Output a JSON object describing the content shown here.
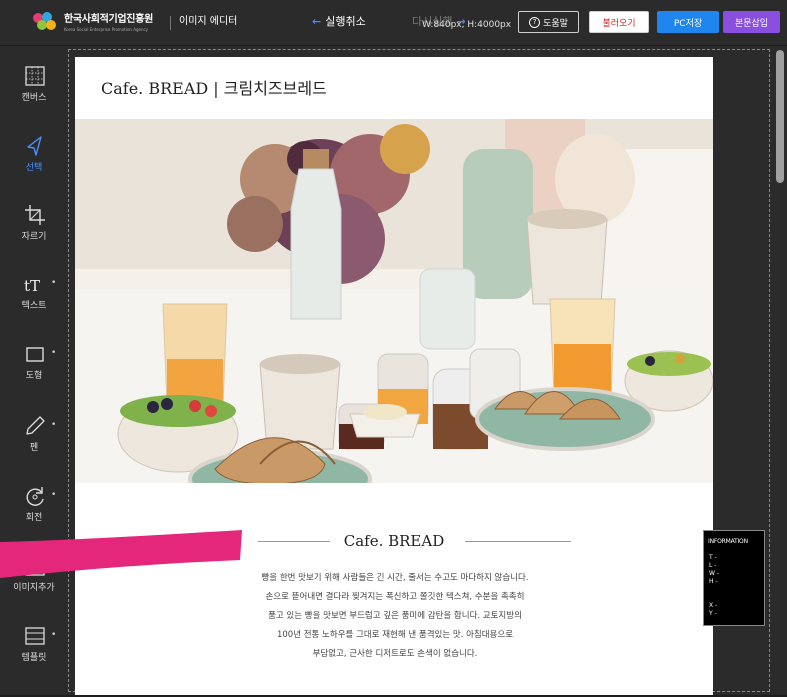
{
  "header": {
    "org_name": "한국사회적기업진흥원",
    "org_sub": "Korea Social Enterprise Promotion Agency",
    "app_title": "이미지 에디터",
    "undo_label": "실행취소",
    "redo_label": "다시실행",
    "size_readout": "W:840px, H:4000px",
    "help_label": "도움말",
    "load_label": "불러오기",
    "save_pc_label": "PC저장",
    "insert_label": "본문삽입"
  },
  "sidebar": {
    "items": [
      {
        "label": "캔버스",
        "icon": "canvas-grid-icon"
      },
      {
        "label": "선택",
        "icon": "select-cursor-icon",
        "active": true
      },
      {
        "label": "자르기",
        "icon": "crop-icon"
      },
      {
        "label": "텍스트",
        "icon": "text-icon"
      },
      {
        "label": "도형",
        "icon": "shape-square-icon"
      },
      {
        "label": "펜",
        "icon": "pen-icon"
      },
      {
        "label": "회전",
        "icon": "rotate-icon"
      },
      {
        "label": "이미지추가",
        "icon": "add-image-icon"
      },
      {
        "label": "템플릿",
        "icon": "template-icon"
      }
    ]
  },
  "canvas": {
    "title": "Cafe. BREAD | 크림치즈브레드",
    "subtitle": "Cafe. BREAD",
    "body_lines": [
      "빵을 한번 맛보기 위해 사람들은 긴 시간, 줄서는 수고도 마다하지 않습니다.",
      "손으로 뜯어내면 결다라 찢겨지는 폭신하고 쫄깃한 텍스쳐, 수분을 촉촉히",
      "품고 있는 빵을 맛보면 부드럽고 깊은 풍미에 감탄을 합니다. 교토지방의",
      "100년 전통 노하우를 그대로 재현해 낸 품격있는 맛. 아침대용으로",
      "부담없고, 근사한 디저트로도 손색이 없습니다."
    ],
    "photo_alt": "cafe-breakfast-table-photo"
  },
  "info_panel": {
    "title": "INFORMATION",
    "lines": [
      "T -",
      "L -",
      "W -",
      "H -",
      "X -",
      "Y -"
    ]
  },
  "colors": {
    "toolbar_bg": "#2b2b2b",
    "accent_blue": "#1f86f0",
    "accent_purple": "#8a4fe0",
    "active_tool": "#4a90ff",
    "pink_stroke": "#e4277a"
  }
}
